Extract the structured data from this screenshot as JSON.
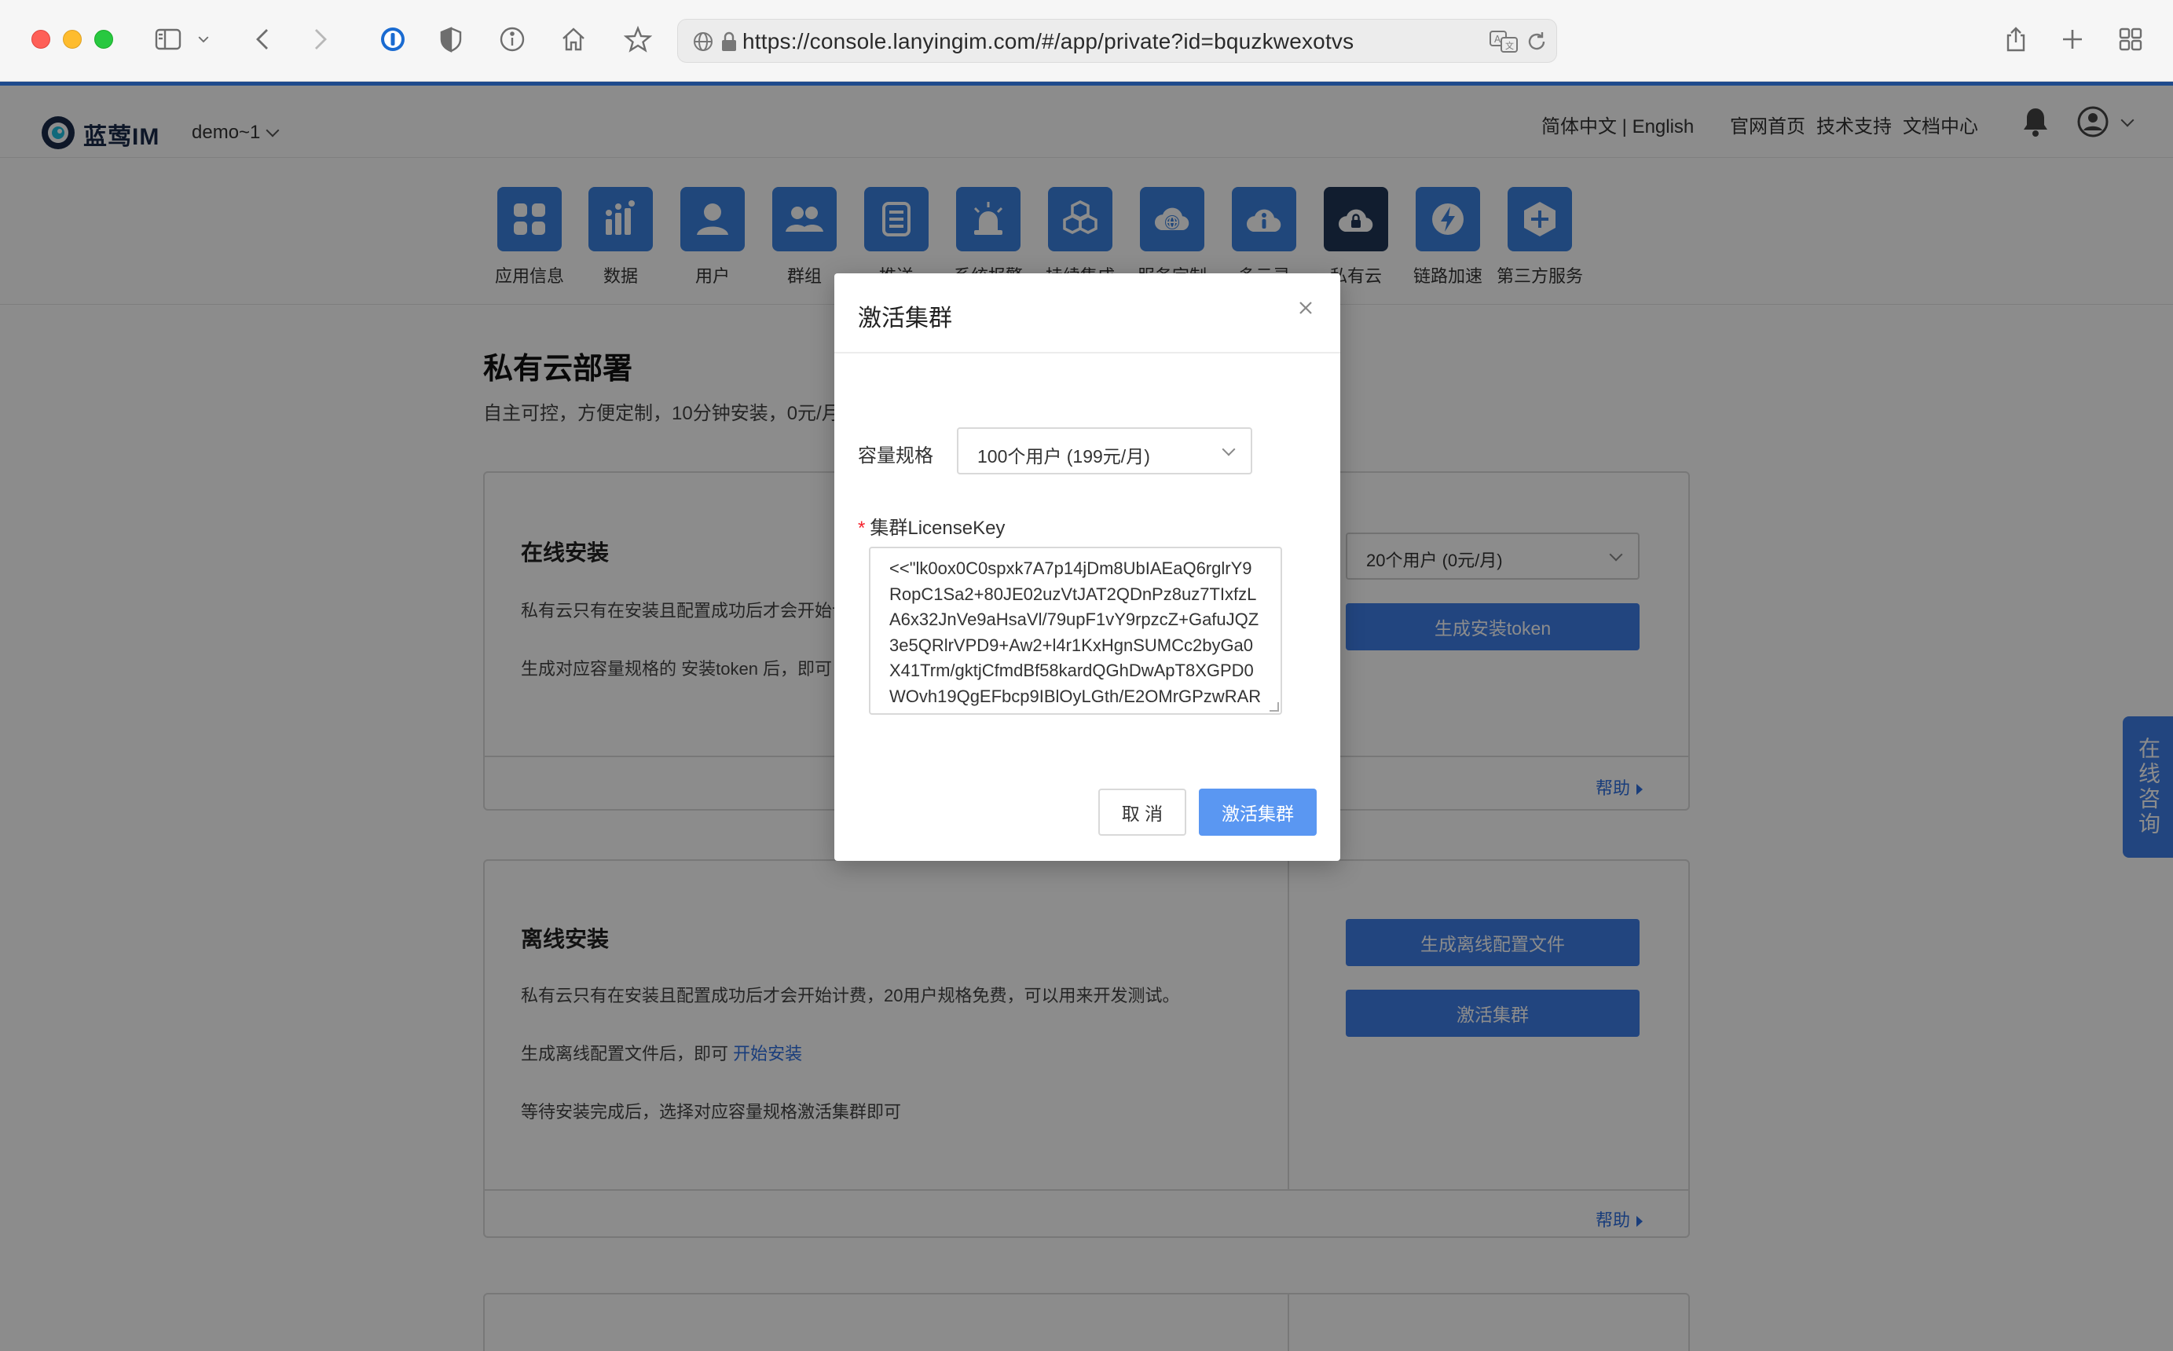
{
  "browser": {
    "url": "https://console.lanyingim.com/#/app/private?id=bquzkwexotvs"
  },
  "header": {
    "logo_text": "蓝莺IM",
    "app_name": "demo~1",
    "lang_switch": "简体中文 | English",
    "links": [
      "官网首页",
      "技术支持",
      "文档中心"
    ]
  },
  "nav": {
    "items": [
      {
        "label": "应用信息",
        "icon": "grid-icon"
      },
      {
        "label": "数据",
        "icon": "bar-chart-icon"
      },
      {
        "label": "用户",
        "icon": "user-icon"
      },
      {
        "label": "群组",
        "icon": "group-icon"
      },
      {
        "label": "推送",
        "icon": "document-icon"
      },
      {
        "label": "系统报警",
        "icon": "alarm-icon"
      },
      {
        "label": "持续集成",
        "icon": "cubes-icon"
      },
      {
        "label": "服务定制",
        "icon": "cloud-globe-icon"
      },
      {
        "label": "多云灵",
        "icon": "cloud-info-icon"
      },
      {
        "label": "私有云",
        "icon": "cloud-lock-icon"
      },
      {
        "label": "链路加速",
        "icon": "bolt-icon"
      },
      {
        "label": "第三方服务",
        "icon": "plus-icon"
      }
    ],
    "active_index": 9
  },
  "page": {
    "title": "私有云部署",
    "subtitle": "自主可控，方便定制，10分钟安装，0元/月"
  },
  "online_card": {
    "title": "在线安装",
    "line1": "私有云只有在安装且配置成功后才会开始计费",
    "line2": "生成对应容量规格的 安装token 后，即可",
    "select_value": "20个用户 (0元/月)",
    "button": "生成安装token",
    "help": "帮助"
  },
  "offline_card": {
    "title": "离线安装",
    "line1": "私有云只有在安装且配置成功后才会开始计费，20用户规格免费，可以用来开发测试。",
    "line2_prefix": "生成离线配置文件后，即可",
    "line2_link": "开始安装",
    "line3": "等待安装完成后，选择对应容量规格激活集群即可",
    "button1": "生成离线配置文件",
    "button2": "激活集群",
    "help": "帮助"
  },
  "float_tab": "在线咨询",
  "dialog": {
    "title": "激活集群",
    "capacity_label": "容量规格",
    "capacity_value": "100个用户 (199元/月)",
    "license_label": "集群LicenseKey",
    "license_value": "<<\"lk0ox0C0spxk7A7p14jDm8UbIAEaQ6rglrY9\nRopC1Sa2+80JE02uzVtJAT2QDnPz8uz7TIxfzL\nA6x32JnVe9aHsaVl/79upF1vY9rpzcZ+GafuJQZ\n3e5QRlrVPD9+Aw2+l4r1KxHgnSUMCc2byGa0\nX41Trm/gktjCfmdBf58kardQGhDwApT8XGPD0\nWOvh19QgEFbcp9IBlOyLGth/E2OMrGPzwRAR",
    "cancel": "取 消",
    "confirm": "激活集群"
  },
  "colors": {
    "accent": "#3f7ee8",
    "nav_tile": "#3b82e0",
    "nav_active": "#1f3656",
    "header_bar": "#1e4a8c",
    "required": "#f5222d"
  }
}
